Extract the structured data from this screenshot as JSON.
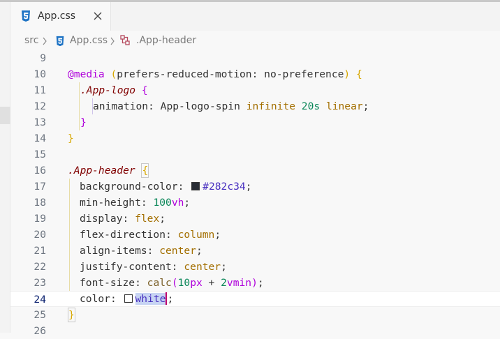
{
  "tab": {
    "filename": "App.css"
  },
  "breadcrumb": {
    "folder": "src",
    "file": "App.css",
    "symbol": ".App-header"
  },
  "colors": {
    "swatch_dark": "#282c34",
    "swatch_white": "#ffffff",
    "accent_cursor": "#c0006b"
  },
  "lines": [
    {
      "n": "9"
    },
    {
      "n": "10",
      "at": "@media",
      "open": " (",
      "prop": "prefers-reduced-motion",
      "colon": ": ",
      "val": "no-preference",
      "close": ")",
      "brace": " {"
    },
    {
      "n": "11",
      "sel": ".App-logo",
      "brace": " {"
    },
    {
      "n": "12",
      "prop": "animation",
      "colon": ": ",
      "name": "App-logo-spin",
      "v1": "infinite",
      "num": "20s",
      "v2": "linear",
      "semi": ";"
    },
    {
      "n": "13",
      "brace": "}"
    },
    {
      "n": "14",
      "brace": "}"
    },
    {
      "n": "15"
    },
    {
      "n": "16",
      "sel": ".App-header",
      "brace": "{"
    },
    {
      "n": "17",
      "prop": "background-color",
      "colon": ": ",
      "val": "#282c34",
      "semi": ";"
    },
    {
      "n": "18",
      "prop": "min-height",
      "colon": ": ",
      "num": "100",
      "unit": "vh",
      "semi": ";"
    },
    {
      "n": "19",
      "prop": "display",
      "colon": ": ",
      "val": "flex",
      "semi": ";"
    },
    {
      "n": "20",
      "prop": "flex-direction",
      "colon": ": ",
      "val": "column",
      "semi": ";"
    },
    {
      "n": "21",
      "prop": "align-items",
      "colon": ": ",
      "val": "center",
      "semi": ";"
    },
    {
      "n": "22",
      "prop": "justify-content",
      "colon": ": ",
      "val": "center",
      "semi": ";"
    },
    {
      "n": "23",
      "prop": "font-size",
      "colon": ": ",
      "fn": "calc",
      "open": "(",
      "n1": "10",
      "u1": "px",
      "op": " + ",
      "n2": "2",
      "u2": "vmin",
      "close": ")",
      "semi": ";"
    },
    {
      "n": "24",
      "prop": "color",
      "colon": ": ",
      "val": "white",
      "semi": ";"
    },
    {
      "n": "25",
      "brace": "}"
    },
    {
      "n": "26"
    }
  ]
}
